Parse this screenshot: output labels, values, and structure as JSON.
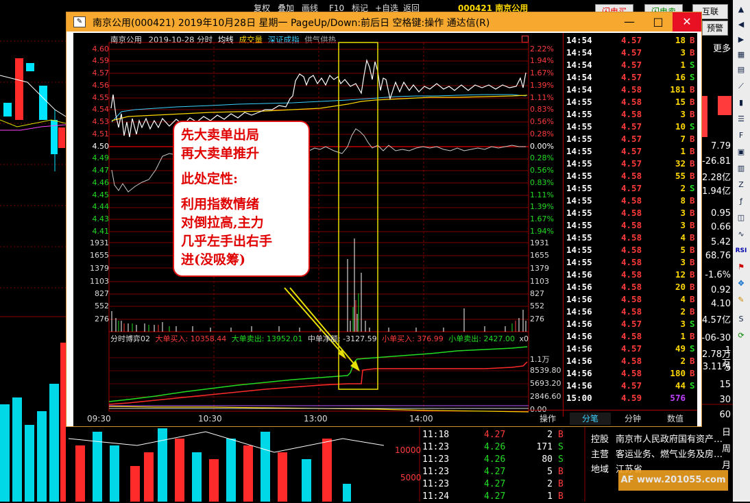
{
  "background_app": {
    "toolbar": [
      "复权",
      "叠加",
      "画线",
      "F10",
      "标记",
      "+自选",
      "返回"
    ],
    "stock_header": "000421 南京公用",
    "buttons": [
      "闪电买",
      "闪电卖",
      "互联",
      "预警"
    ],
    "right_panel_values": [
      "更多",
      "7.79",
      "-26.81",
      "2.28亿",
      "1.94亿",
      "0.95",
      "0.66",
      "5.42",
      "68.76",
      "-1.6%",
      "0.92",
      "4.10",
      "4.57亿",
      "-06-30",
      "2.78万",
      "3.11%",
      "1万",
      "5",
      "15",
      "30",
      "60",
      "日",
      "周",
      "月",
      "多"
    ],
    "volume_axis": [
      "10000",
      "5000"
    ],
    "trades": [
      {
        "time": "11:18",
        "price": "4.27",
        "vol": "2",
        "side": "B"
      },
      {
        "time": "11:23",
        "price": "4.26",
        "vol": "171",
        "side": "S"
      },
      {
        "time": "11:23",
        "price": "4.26",
        "vol": "80",
        "side": "S"
      },
      {
        "time": "11:23",
        "price": "4.27",
        "vol": "5",
        "side": "B"
      },
      {
        "time": "11:23",
        "price": "4.27",
        "vol": "2",
        "side": "B"
      },
      {
        "time": "11:24",
        "price": "4.27",
        "vol": "1",
        "side": "B"
      }
    ],
    "company_info": {
      "holder_label": "控股",
      "holder_value": "南京市人民政府国有资产…",
      "business_label": "主营",
      "business_value": "客运业务、燃气业务及房…",
      "region_label": "地域",
      "region_value": "江苏省"
    },
    "watermark": "AF www.201055.com"
  },
  "dialog": {
    "title": "南京公用(000421) 2019年10月28日 星期一 PageUp/Down:前后日 空格键:操作 通达信(R)",
    "window_buttons": {
      "minimize": "—",
      "maximize": "□",
      "close": "✕"
    },
    "chart_header": {
      "name": "南京公用",
      "date": "2019-10-28 分时",
      "avg_label": "均线",
      "vol_label": "成交量",
      "index_label": "深证成指",
      "supply_label": "供气供热"
    },
    "price_labels": [
      "4.60",
      "4.59",
      "4.57",
      "4.56",
      "4.55",
      "4.54",
      "4.53",
      "4.51",
      "4.50",
      "4.49",
      "4.47",
      "4.46",
      "4.45",
      "4.44",
      "4.43",
      "4.41"
    ],
    "pct_labels": [
      "2.22%",
      "1.94%",
      "1.67%",
      "1.39%",
      "1.11%",
      "0.83%",
      "0.56%",
      "0.28%",
      "0.00%",
      "0.28%",
      "0.56%",
      "0.83%",
      "1.11%",
      "1.39%",
      "1.67%",
      "1.94%"
    ],
    "volume_labels": [
      "1931",
      "1655",
      "1379",
      "1103",
      "827",
      "552",
      "276"
    ],
    "game_header": {
      "title": "分时博弈02",
      "big_buy": "大单买入: 10358.44",
      "big_sell": "大单卖出: 13952.01",
      "mid_net": "中单净额: -3127.59",
      "small_buy": "小单买入: 376.99",
      "small_sell": "小单卖出: 2427.00",
      "tail": "x0"
    },
    "game_labels": [
      "1.1万",
      "8539.80",
      "5693.20",
      "2846.60",
      "0.00"
    ],
    "time_labels": [
      "09:30",
      "10:30",
      "13:00",
      "14:00"
    ],
    "tabs": [
      "操作",
      "分笔",
      "分钟",
      "数值"
    ],
    "ticks": [
      {
        "time": "14:54",
        "price": "4.57",
        "vol": "18",
        "side": "B"
      },
      {
        "time": "14:54",
        "price": "4.57",
        "vol": "3",
        "side": "B"
      },
      {
        "time": "14:54",
        "price": "4.57",
        "vol": "1",
        "side": "S"
      },
      {
        "time": "14:54",
        "price": "4.57",
        "vol": "16",
        "side": "S"
      },
      {
        "time": "14:54",
        "price": "4.58",
        "vol": "181",
        "side": "B"
      },
      {
        "time": "14:55",
        "price": "4.58",
        "vol": "15",
        "side": "B"
      },
      {
        "time": "14:55",
        "price": "4.58",
        "vol": "3",
        "side": "B"
      },
      {
        "time": "14:55",
        "price": "4.57",
        "vol": "10",
        "side": "S"
      },
      {
        "time": "14:55",
        "price": "4.57",
        "vol": "7",
        "side": "B"
      },
      {
        "time": "14:55",
        "price": "4.57",
        "vol": "1",
        "side": "B"
      },
      {
        "time": "14:55",
        "price": "4.57",
        "vol": "32",
        "side": "B"
      },
      {
        "time": "14:55",
        "price": "4.58",
        "vol": "55",
        "side": "B"
      },
      {
        "time": "14:55",
        "price": "4.57",
        "vol": "2",
        "side": "S"
      },
      {
        "time": "14:55",
        "price": "4.58",
        "vol": "8",
        "side": "B"
      },
      {
        "time": "14:55",
        "price": "4.58",
        "vol": "3",
        "side": "B"
      },
      {
        "time": "14:55",
        "price": "4.58",
        "vol": "3",
        "side": "B"
      },
      {
        "time": "14:55",
        "price": "4.58",
        "vol": "4",
        "side": "B"
      },
      {
        "time": "14:55",
        "price": "4.58",
        "vol": "5",
        "side": "B"
      },
      {
        "time": "14:55",
        "price": "4.58",
        "vol": "3",
        "side": "B"
      },
      {
        "time": "14:56",
        "price": "4.58",
        "vol": "12",
        "side": "B"
      },
      {
        "time": "14:56",
        "price": "4.58",
        "vol": "20",
        "side": "B"
      },
      {
        "time": "14:56",
        "price": "4.58",
        "vol": "4",
        "side": "B"
      },
      {
        "time": "14:56",
        "price": "4.58",
        "vol": "2",
        "side": "B"
      },
      {
        "time": "14:56",
        "price": "4.57",
        "vol": "3",
        "side": "S"
      },
      {
        "time": "14:56",
        "price": "4.58",
        "vol": "1",
        "side": "B"
      },
      {
        "time": "14:56",
        "price": "4.57",
        "vol": "49",
        "side": "S"
      },
      {
        "time": "14:56",
        "price": "4.58",
        "vol": "2",
        "side": "B"
      },
      {
        "time": "14:56",
        "price": "4.58",
        "vol": "180",
        "side": "B"
      },
      {
        "time": "14:56",
        "price": "4.57",
        "vol": "44",
        "side": "S"
      },
      {
        "time": "15:00",
        "price": "4.59",
        "vol": "576",
        "side": ""
      }
    ],
    "annotation": {
      "line1": "先大卖单出局",
      "line2": "再大卖单推升",
      "line3": "此处定性:",
      "line4": "利用指数情绪",
      "line5": "对倒拉高,主力",
      "line6": "几乎左手出右手",
      "line7": "进(没吸筹)"
    }
  },
  "colors": {
    "title_bar": "#f6a92e",
    "up_red": "#ff3b3b",
    "down_green": "#22dd22",
    "highlight_box": "#e8e000",
    "annotation_red": "#e00000"
  }
}
